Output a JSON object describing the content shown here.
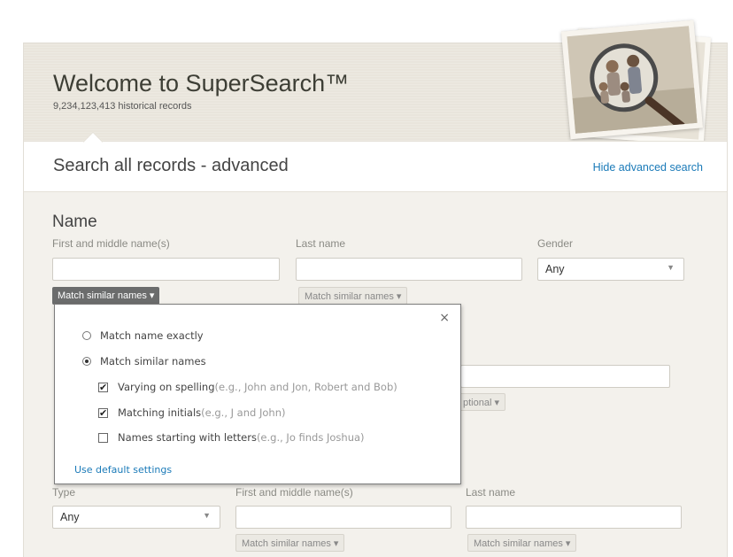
{
  "hero": {
    "title": "Welcome to SuperSearch™",
    "subtitle": "9,234,123,413 historical records"
  },
  "header": {
    "title": "Search all records - advanced",
    "hide_link": "Hide advanced search"
  },
  "name_section": {
    "title": "Name",
    "first_label": "First and middle name(s)",
    "last_label": "Last name",
    "gender_label": "Gender",
    "gender_value": "Any",
    "match_first": "Match similar names",
    "match_last": "Match similar names"
  },
  "popup": {
    "close": "×",
    "opt_exact": "Match name exactly",
    "opt_similar": "Match similar names",
    "chk1_label": "Varying on spelling",
    "chk1_example": " (e.g., John and Jon, Robert and Bob)",
    "chk2_label": "Matching initials",
    "chk2_example": " (e.g., J and John)",
    "chk3_label": "Names starting with letters",
    "chk3_example": " (e.g., Jo finds Joshua)",
    "default_link": "Use default settings",
    "selected": "similar",
    "checked": [
      true,
      true,
      false
    ]
  },
  "behind": {
    "optional_pill": "ptional"
  },
  "relative_section": {
    "type_label": "Type",
    "type_value": "Any",
    "first_label": "First and middle name(s)",
    "last_label": "Last name",
    "match_first": "Match similar names",
    "match_last": "Match similar names"
  }
}
